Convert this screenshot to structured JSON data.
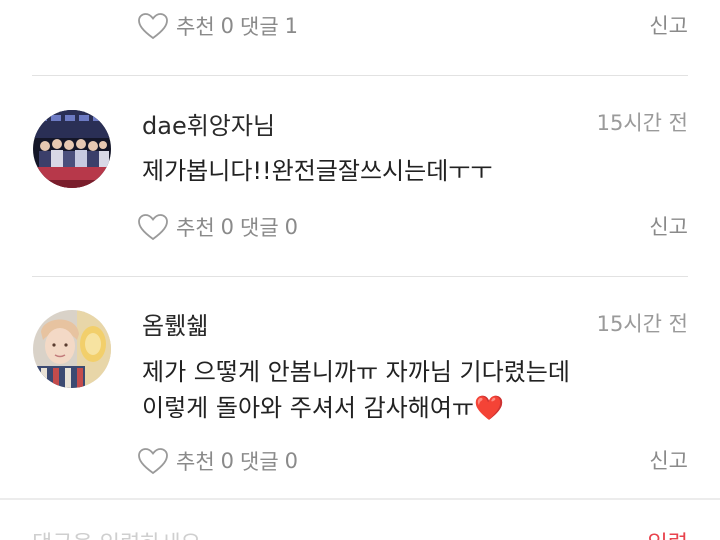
{
  "top_comment": {
    "like_label": "추천",
    "like_count": "0",
    "reply_label": "댓글",
    "reply_count": "1",
    "report_label": "신고"
  },
  "comments": [
    {
      "username": "dae휘앙자님",
      "time": "15시간 전",
      "text_lines": [
        "제가봅니다!!완전글잘쓰시는데ㅜㅜ"
      ],
      "like_label": "추천",
      "like_count": "0",
      "reply_label": "댓글",
      "reply_count": "0",
      "report_label": "신고",
      "avatar_colors": [
        "#1b1b2f",
        "#b7384a"
      ]
    },
    {
      "username": "옴뤬쉛",
      "time": "15시간 전",
      "text_lines": [
        "제가 으떻게 안봄니까ㅠ 자까님 기다렸는데",
        "이렇게 돌아와 주셔서 감사해여ㅠ❤️"
      ],
      "like_label": "추천",
      "like_count": "0",
      "reply_label": "댓글",
      "reply_count": "0",
      "report_label": "신고",
      "avatar_colors": [
        "#e9c4a6",
        "#f2cf6b"
      ]
    }
  ],
  "composer": {
    "placeholder": "댓글을 입력하세요",
    "submit_label": "입력"
  },
  "colors": {
    "accent": "#e8434d",
    "muted_text": "#8a8a8a",
    "divider": "#e2e2e2"
  }
}
